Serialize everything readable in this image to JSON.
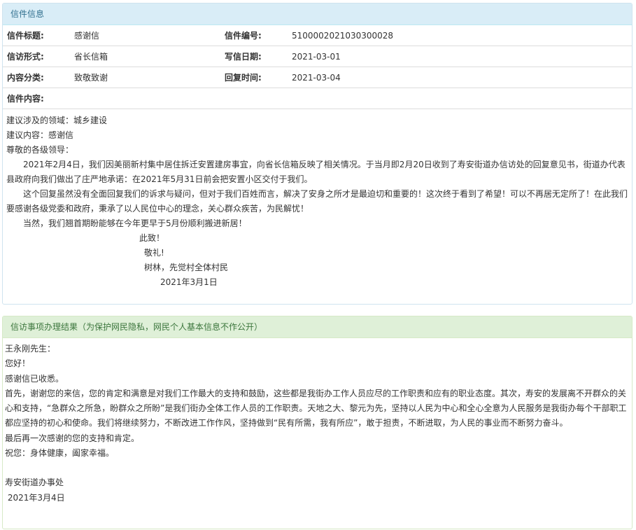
{
  "letter_panel": {
    "title": "信件信息",
    "fields": {
      "title_label": "信件标题:",
      "title_value": "感谢信",
      "number_label": "信件编号:",
      "number_value": "5100002021030300028",
      "form_label": "信访形式:",
      "form_value": "省长信箱",
      "write_date_label": "写信日期:",
      "write_date_value": "2021-03-01",
      "category_label": "内容分类:",
      "category_value": "致敬致谢",
      "reply_time_label": "回复时间:",
      "reply_time_value": "2021-03-04",
      "content_label": "信件内容:"
    },
    "content": {
      "domain": "建议涉及的领域：城乡建设",
      "suggestion": "建议内容：感谢信",
      "greeting": "尊敬的各级领导：",
      "para1": "2021年2月4日，我们因美丽新村集中居住拆迁安置建房事宜，向省长信箱反映了相关情况。于当月即2月20日收到了寿安街道办信访处的回复意见书，街道办代表县政府向我们做出了庄严地承诺：在2021年5月31日前会把安置小区交付于我们。",
      "para2": "这个回复虽然没有全面回复我们的诉求与疑问，但对于我们百姓而言，解决了安身之所才是最迫切和重要的！这次终于看到了希望！可以不再居无定所了！在此我们要感谢各级党委和政府，秉承了以人民位中心的理念，关心群众疾苦，为民解忧！",
      "para3": "当然，我们翘首期盼能够在今年更早于5月份顺利搬进新居！",
      "closing1": "此致！",
      "closing2": "敬礼!",
      "signature": "树林，先觉村全体村民",
      "date": "2021年3月1日"
    }
  },
  "result_panel": {
    "title": "信访事项办理结果（为保护网民隐私，网民个人基本信息不作公开）",
    "salutation": "王永刚先生：",
    "hello": "您好！",
    "received": "感谢信已收悉。",
    "body": "首先，谢谢您的来信，您的肯定和满意是对我们工作最大的支持和鼓励，这些都是我街办工作人员应尽的工作职责和应有的职业态度。其次，寿安的发展离不开群众的关心和支持，“急群众之所急，盼群众之所盼”是我们街办全体工作人员的工作职责。天地之大、黎元为先，坚持以人民为中心和全心全意为人民服务是我街办每个干部职工都应坚持的初心和使命。我们将继续努力，不断改进工作作风，坚持做到“民有所需，我有所应”，敢于担责，不断进取，为人民的事业而不断努力奋斗。",
    "thanks_again": "最后再一次感谢的您的支持和肯定。",
    "wish": "祝您：身体健康，阖家幸福。",
    "office": "寿安街道办事处",
    "date": " 2021年3月4日"
  }
}
